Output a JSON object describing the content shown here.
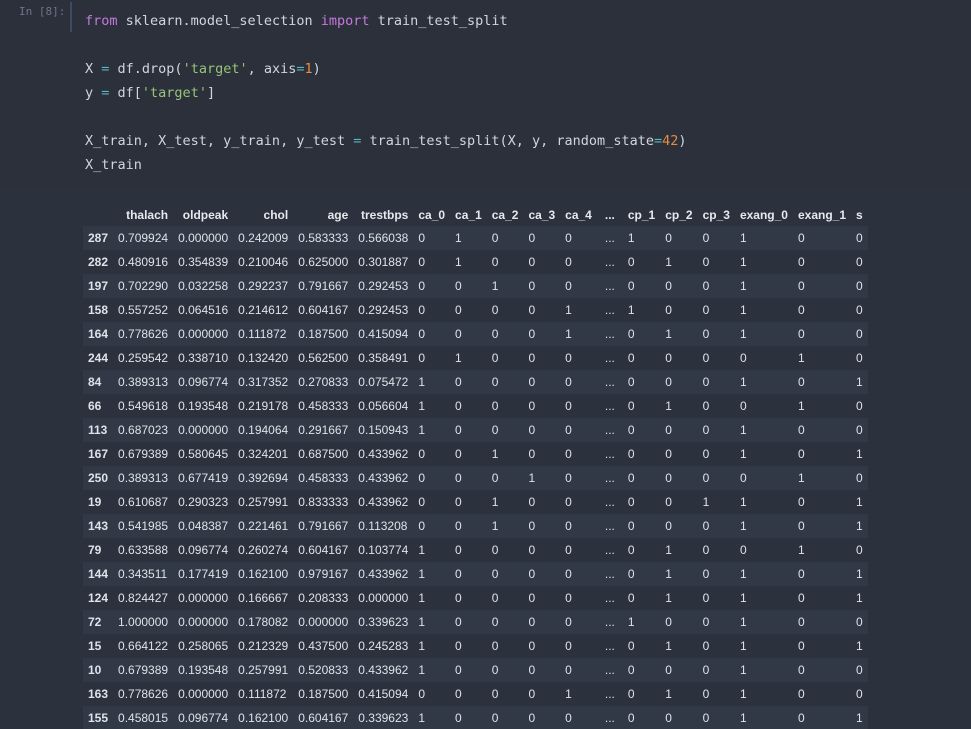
{
  "cell": {
    "prompt": "In [8]:",
    "code_lines": [
      [
        {
          "t": "from",
          "c": "kw"
        },
        {
          "t": " sklearn.model_selection "
        },
        {
          "t": "import",
          "c": "kw"
        },
        {
          "t": " train_test_split"
        }
      ],
      [],
      [
        {
          "t": "X "
        },
        {
          "t": "=",
          "c": "op"
        },
        {
          "t": " df.drop("
        },
        {
          "t": "'target'",
          "c": "str"
        },
        {
          "t": ", axis"
        },
        {
          "t": "=",
          "c": "op"
        },
        {
          "t": "1",
          "c": "num"
        },
        {
          "t": ")"
        }
      ],
      [
        {
          "t": "y "
        },
        {
          "t": "=",
          "c": "op"
        },
        {
          "t": " df["
        },
        {
          "t": "'target'",
          "c": "str"
        },
        {
          "t": "]"
        }
      ],
      [],
      [
        {
          "t": "X_train, X_test, y_train, y_test "
        },
        {
          "t": "=",
          "c": "op"
        },
        {
          "t": " train_test_split(X, y, random_state"
        },
        {
          "t": "=",
          "c": "op"
        },
        {
          "t": "42",
          "c": "num"
        },
        {
          "t": ")"
        }
      ],
      [
        {
          "t": "X_train"
        }
      ]
    ]
  },
  "dataframe": {
    "columns": [
      "",
      "thalach",
      "oldpeak",
      "chol",
      "age",
      "trestbps",
      "ca_0",
      "ca_1",
      "ca_2",
      "ca_3",
      "ca_4",
      "...",
      "cp_1",
      "cp_2",
      "cp_3",
      "exang_0",
      "exang_1",
      "s"
    ],
    "rows": [
      [
        "287",
        "0.709924",
        "0.000000",
        "0.242009",
        "0.583333",
        "0.566038",
        "0",
        "1",
        "0",
        "0",
        "0",
        "...",
        "1",
        "0",
        "0",
        "1",
        "0",
        "0"
      ],
      [
        "282",
        "0.480916",
        "0.354839",
        "0.210046",
        "0.625000",
        "0.301887",
        "0",
        "1",
        "0",
        "0",
        "0",
        "...",
        "0",
        "1",
        "0",
        "1",
        "0",
        "0"
      ],
      [
        "197",
        "0.702290",
        "0.032258",
        "0.292237",
        "0.791667",
        "0.292453",
        "0",
        "0",
        "1",
        "0",
        "0",
        "...",
        "0",
        "0",
        "0",
        "1",
        "0",
        "0"
      ],
      [
        "158",
        "0.557252",
        "0.064516",
        "0.214612",
        "0.604167",
        "0.292453",
        "0",
        "0",
        "0",
        "0",
        "1",
        "...",
        "1",
        "0",
        "0",
        "1",
        "0",
        "0"
      ],
      [
        "164",
        "0.778626",
        "0.000000",
        "0.111872",
        "0.187500",
        "0.415094",
        "0",
        "0",
        "0",
        "0",
        "1",
        "...",
        "0",
        "1",
        "0",
        "1",
        "0",
        "0"
      ],
      [
        "244",
        "0.259542",
        "0.338710",
        "0.132420",
        "0.562500",
        "0.358491",
        "0",
        "1",
        "0",
        "0",
        "0",
        "...",
        "0",
        "0",
        "0",
        "0",
        "1",
        "0"
      ],
      [
        "84",
        "0.389313",
        "0.096774",
        "0.317352",
        "0.270833",
        "0.075472",
        "1",
        "0",
        "0",
        "0",
        "0",
        "...",
        "0",
        "0",
        "0",
        "1",
        "0",
        "1"
      ],
      [
        "66",
        "0.549618",
        "0.193548",
        "0.219178",
        "0.458333",
        "0.056604",
        "1",
        "0",
        "0",
        "0",
        "0",
        "...",
        "0",
        "1",
        "0",
        "0",
        "1",
        "0"
      ],
      [
        "113",
        "0.687023",
        "0.000000",
        "0.194064",
        "0.291667",
        "0.150943",
        "1",
        "0",
        "0",
        "0",
        "0",
        "...",
        "0",
        "0",
        "0",
        "1",
        "0",
        "0"
      ],
      [
        "167",
        "0.679389",
        "0.580645",
        "0.324201",
        "0.687500",
        "0.433962",
        "0",
        "0",
        "1",
        "0",
        "0",
        "...",
        "0",
        "0",
        "0",
        "1",
        "0",
        "1"
      ],
      [
        "250",
        "0.389313",
        "0.677419",
        "0.392694",
        "0.458333",
        "0.433962",
        "0",
        "0",
        "0",
        "1",
        "0",
        "...",
        "0",
        "0",
        "0",
        "0",
        "1",
        "0"
      ],
      [
        "19",
        "0.610687",
        "0.290323",
        "0.257991",
        "0.833333",
        "0.433962",
        "0",
        "0",
        "1",
        "0",
        "0",
        "...",
        "0",
        "0",
        "1",
        "1",
        "0",
        "1"
      ],
      [
        "143",
        "0.541985",
        "0.048387",
        "0.221461",
        "0.791667",
        "0.113208",
        "0",
        "0",
        "1",
        "0",
        "0",
        "...",
        "0",
        "0",
        "0",
        "1",
        "0",
        "1"
      ],
      [
        "79",
        "0.633588",
        "0.096774",
        "0.260274",
        "0.604167",
        "0.103774",
        "1",
        "0",
        "0",
        "0",
        "0",
        "...",
        "0",
        "1",
        "0",
        "0",
        "1",
        "0"
      ],
      [
        "144",
        "0.343511",
        "0.177419",
        "0.162100",
        "0.979167",
        "0.433962",
        "1",
        "0",
        "0",
        "0",
        "0",
        "...",
        "0",
        "1",
        "0",
        "1",
        "0",
        "1"
      ],
      [
        "124",
        "0.824427",
        "0.000000",
        "0.166667",
        "0.208333",
        "0.000000",
        "1",
        "0",
        "0",
        "0",
        "0",
        "...",
        "0",
        "1",
        "0",
        "1",
        "0",
        "1"
      ],
      [
        "72",
        "1.000000",
        "0.000000",
        "0.178082",
        "0.000000",
        "0.339623",
        "1",
        "0",
        "0",
        "0",
        "0",
        "...",
        "1",
        "0",
        "0",
        "1",
        "0",
        "0"
      ],
      [
        "15",
        "0.664122",
        "0.258065",
        "0.212329",
        "0.437500",
        "0.245283",
        "1",
        "0",
        "0",
        "0",
        "0",
        "...",
        "0",
        "1",
        "0",
        "1",
        "0",
        "1"
      ],
      [
        "10",
        "0.679389",
        "0.193548",
        "0.257991",
        "0.520833",
        "0.433962",
        "1",
        "0",
        "0",
        "0",
        "0",
        "...",
        "0",
        "0",
        "0",
        "1",
        "0",
        "0"
      ],
      [
        "163",
        "0.778626",
        "0.000000",
        "0.111872",
        "0.187500",
        "0.415094",
        "0",
        "0",
        "0",
        "0",
        "1",
        "...",
        "0",
        "1",
        "0",
        "1",
        "0",
        "0"
      ],
      [
        "155",
        "0.458015",
        "0.096774",
        "0.162100",
        "0.604167",
        "0.339623",
        "1",
        "0",
        "0",
        "0",
        "0",
        "...",
        "0",
        "0",
        "0",
        "1",
        "0",
        "1"
      ]
    ]
  },
  "colors": {
    "keyword": "#c678dd",
    "string": "#98c379",
    "number": "#e78c45",
    "operator": "#56b6c2"
  }
}
